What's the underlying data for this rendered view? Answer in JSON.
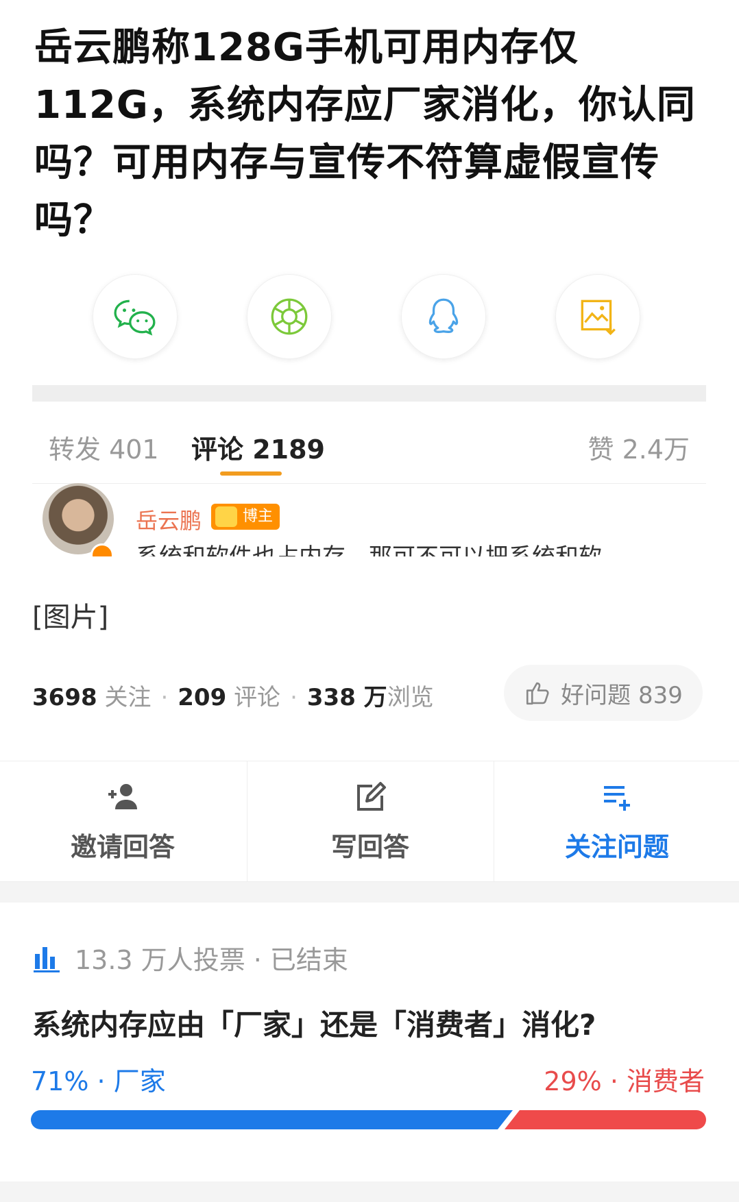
{
  "question": {
    "title": "岳云鹏称128G手机可用内存仅112G，系统内存应厂家消化，你认同吗？可用内存与宣传不符算虚假宣传吗？"
  },
  "share": {
    "items": [
      {
        "icon": "wechat-icon",
        "color": "#22b14c"
      },
      {
        "icon": "moments-icon",
        "color": "#7cc93a"
      },
      {
        "icon": "qq-icon",
        "color": "#4aa3e8"
      },
      {
        "icon": "save-image-icon",
        "color": "#f2b416"
      }
    ]
  },
  "tabs": {
    "repost": "转发 401",
    "comments": "评论 2189",
    "likes": "赞 2.4万"
  },
  "comment": {
    "author": "岳云鹏",
    "badge": "博主",
    "text": "系统和软件也占内存，那可不可以把系统和软"
  },
  "content": {
    "image_placeholder": "[图片]"
  },
  "stats": {
    "follow_count": "3698",
    "follow_label": "关注",
    "comment_count": "209",
    "comment_label": "评论",
    "view_count": "338 万",
    "view_label": "浏览",
    "good_question": "好问题 839"
  },
  "actions": {
    "invite": "邀请回答",
    "write": "写回答",
    "follow": "关注问题"
  },
  "poll": {
    "status": "13.3 万人投票 · 已结束",
    "question": "系统内存应由「厂家」还是「消费者」消化?",
    "left_label": "71% · 厂家",
    "right_label": "29% · 消费者",
    "left_percent": 71,
    "right_percent": 29,
    "colors": {
      "left": "#1d7ae8",
      "right": "#ef4a4a"
    }
  }
}
